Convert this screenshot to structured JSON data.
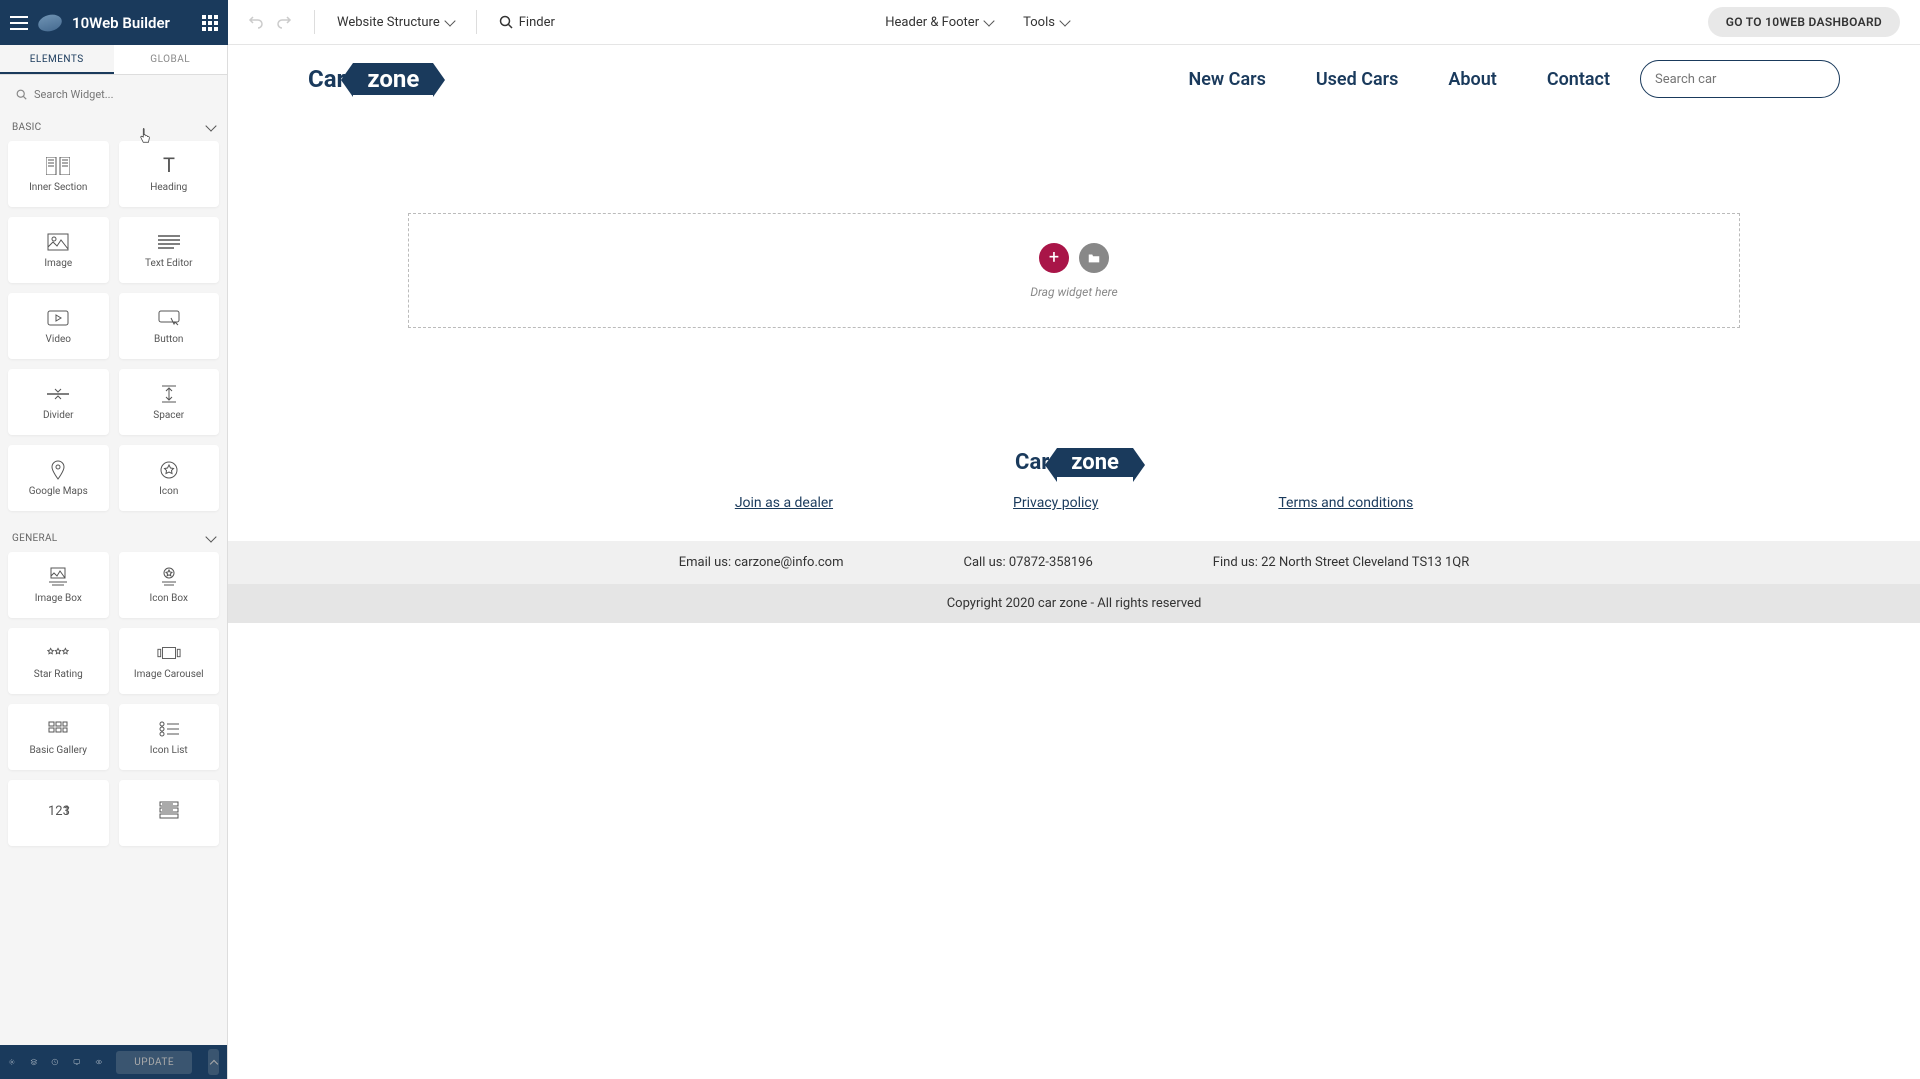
{
  "topbar": {
    "logo_text": "10Web Builder",
    "structure": "Website Structure",
    "finder": "Finder",
    "header_footer": "Header & Footer",
    "tools": "Tools",
    "dashboard": "GO TO 10WEB DASHBOARD"
  },
  "sidebar": {
    "tabs": {
      "elements": "ELEMENTS",
      "global": "GLOBAL"
    },
    "search_placeholder": "Search Widget...",
    "sections": {
      "basic": "BASIC",
      "general": "GENERAL"
    },
    "widgets_basic": [
      {
        "label": "Inner Section",
        "icon": "inner-section"
      },
      {
        "label": "Heading",
        "icon": "heading"
      },
      {
        "label": "Image",
        "icon": "image"
      },
      {
        "label": "Text Editor",
        "icon": "text-editor"
      },
      {
        "label": "Video",
        "icon": "video"
      },
      {
        "label": "Button",
        "icon": "button"
      },
      {
        "label": "Divider",
        "icon": "divider"
      },
      {
        "label": "Spacer",
        "icon": "spacer"
      },
      {
        "label": "Google Maps",
        "icon": "map"
      },
      {
        "label": "Icon",
        "icon": "star"
      }
    ],
    "widgets_general": [
      {
        "label": "Image Box",
        "icon": "image-box"
      },
      {
        "label": "Icon Box",
        "icon": "icon-box"
      },
      {
        "label": "Star Rating",
        "icon": "stars"
      },
      {
        "label": "Image Carousel",
        "icon": "carousel"
      },
      {
        "label": "Basic Gallery",
        "icon": "gallery"
      },
      {
        "label": "Icon List",
        "icon": "icon-list"
      },
      {
        "label": "",
        "icon": "counter"
      },
      {
        "label": "",
        "icon": "accordion"
      }
    ],
    "update": "UPDATE"
  },
  "site": {
    "logo": {
      "part1": "Car",
      "part2": "zone"
    },
    "nav": [
      "New Cars",
      "Used Cars",
      "About",
      "Contact"
    ],
    "search_placeholder": "Search car",
    "dropzone_text": "Drag widget here",
    "footer": {
      "links": [
        "Join as a dealer",
        "Privacy policy",
        "Terms and conditions"
      ],
      "contact": [
        "Email us: carzone@info.com",
        "Call us: 07872-358196",
        "Find us: 22 North Street Cleveland TS13 1QR"
      ],
      "copyright": "Copyright 2020 car zone - All rights reserved"
    }
  }
}
